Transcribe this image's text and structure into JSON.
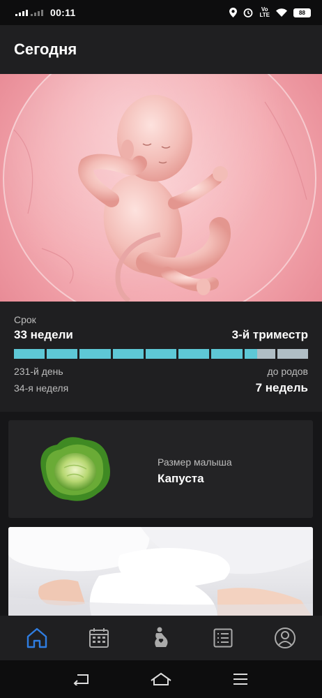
{
  "status_bar": {
    "time": "00:11",
    "network": "LTE",
    "battery": "88",
    "icons": [
      "signal-icon",
      "location-icon",
      "alarm-icon",
      "volte-icon",
      "wifi-icon",
      "battery-icon"
    ]
  },
  "header": {
    "title": "Сегодня"
  },
  "hero": {
    "image": "fetus-illustration"
  },
  "term": {
    "label": "Срок",
    "weeks": "33 недели",
    "trimester": "3-й триместр",
    "progress_segments": 9,
    "progress_fraction": 0.825,
    "day": "231-й день",
    "week": "34-я неделя",
    "until_label": "до родов",
    "until_value": "7 недель",
    "colors": {
      "fill": "#5ec8d6",
      "empty": "#b0bec5"
    }
  },
  "size_card": {
    "image": "cabbage",
    "label": "Размер малыша",
    "value": "Капуста"
  },
  "article_card": {
    "image": "woman-in-bed"
  },
  "bottom_nav": {
    "items": [
      {
        "icon": "home-icon",
        "active": true
      },
      {
        "icon": "calendar-icon",
        "active": false
      },
      {
        "icon": "pregnancy-icon",
        "active": false
      },
      {
        "icon": "list-icon",
        "active": false
      },
      {
        "icon": "profile-icon",
        "active": false
      }
    ],
    "active_color": "#2f7de1"
  },
  "system_nav": {
    "icons": [
      "back-icon",
      "home-system-icon",
      "menu-icon"
    ]
  }
}
